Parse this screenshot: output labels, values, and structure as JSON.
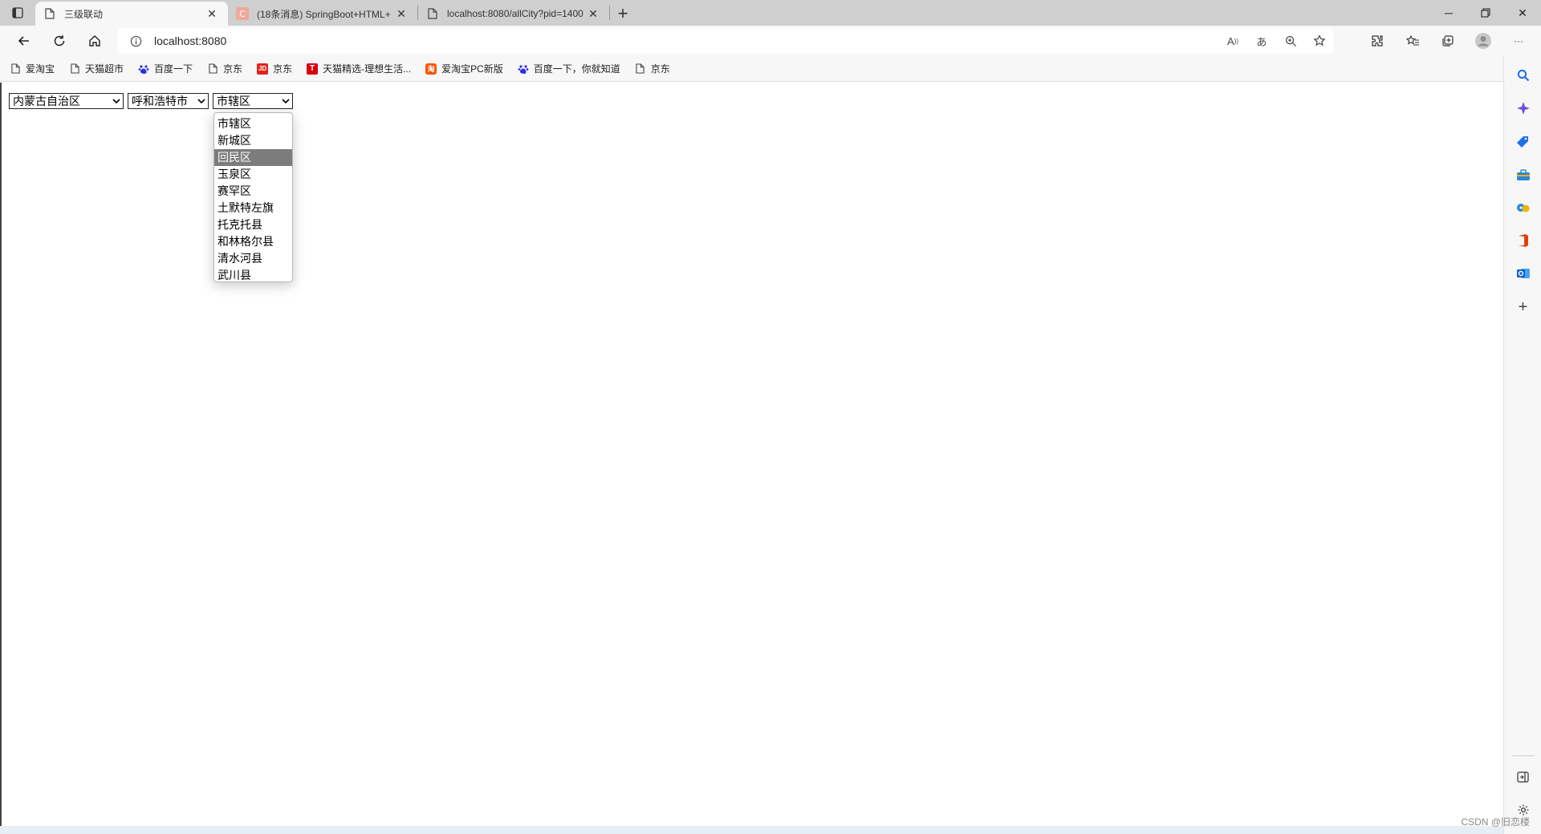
{
  "tabs": [
    {
      "title": "三级联动",
      "active": true
    },
    {
      "title": "(18条消息) SpringBoot+HTML+",
      "active": false
    },
    {
      "title": "localhost:8080/allCity?pid=1400",
      "active": false
    }
  ],
  "address": {
    "url": "localhost:8080"
  },
  "bookmarks": [
    {
      "label": "爱淘宝",
      "icon": "page-icon"
    },
    {
      "label": "天猫超市",
      "icon": "page-icon"
    },
    {
      "label": "百度一下",
      "icon": "baidu-paw-icon"
    },
    {
      "label": "京东",
      "icon": "page-icon"
    },
    {
      "label": "京东",
      "icon": "jd-icon",
      "badge": "JD"
    },
    {
      "label": "天猫精选-理想生活...",
      "icon": "tmall-icon",
      "badge": "T"
    },
    {
      "label": "爱淘宝PC新版",
      "icon": "aitaobao-icon",
      "badge": "淘"
    },
    {
      "label": "百度一下，你就知道",
      "icon": "baidu-paw-icon"
    },
    {
      "label": "京东",
      "icon": "page-icon"
    }
  ],
  "selects": {
    "province": "内蒙古自治区",
    "city": "呼和浩特市",
    "district": "市辖区"
  },
  "district_options": [
    {
      "label": "市辖区",
      "highlighted": false
    },
    {
      "label": "新城区",
      "highlighted": false
    },
    {
      "label": "回民区",
      "highlighted": true
    },
    {
      "label": "玉泉区",
      "highlighted": false
    },
    {
      "label": "赛罕区",
      "highlighted": false
    },
    {
      "label": "土默特左旗",
      "highlighted": false
    },
    {
      "label": "托克托县",
      "highlighted": false
    },
    {
      "label": "和林格尔县",
      "highlighted": false
    },
    {
      "label": "清水河县",
      "highlighted": false
    },
    {
      "label": "武川县",
      "highlighted": false
    }
  ],
  "colors": {
    "tabstrip": "#cfcfcf",
    "toolbar": "#f7f7f7",
    "highlight": "#7c7c7c",
    "jd": "#e1251b",
    "tmall": "#d6000f",
    "baidu": "#2932e1",
    "copilot": "#6b4fd8",
    "search": "#1f6feb"
  },
  "watermark": "CSDN @旧恋楼"
}
